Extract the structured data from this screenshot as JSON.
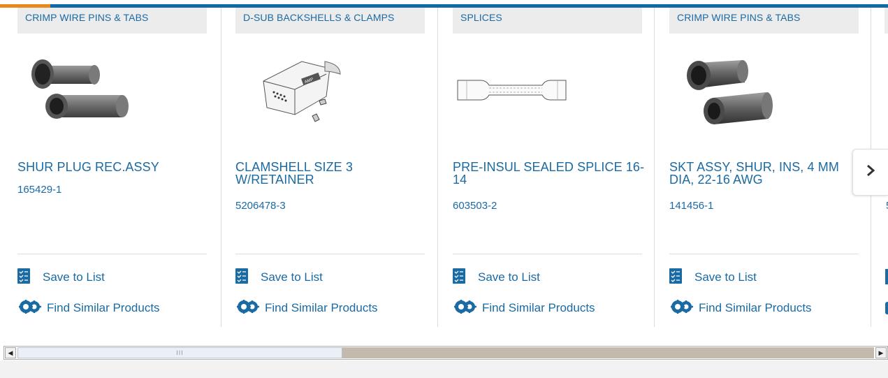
{
  "colors": {
    "accent_blue": "#1a6aa4",
    "top_bar": "#0f6aa8",
    "top_bar_accent": "#e8891d",
    "category_bg": "#ececec"
  },
  "cards": [
    {
      "category": "CRIMP WIRE PINS & TABS",
      "title": "SHUR PLUG REC.ASSY",
      "part_number": "165429-1",
      "save_label": "Save to List",
      "similar_label": "Find Similar Products",
      "image_icon": "crimp-plug-image"
    },
    {
      "category": "D-SUB BACKSHELLS & CLAMPS",
      "title": "CLAMSHELL SIZE 3 W/RETAINER",
      "part_number": "5206478-3",
      "save_label": "Save to List",
      "similar_label": "Find Similar Products",
      "image_icon": "dsub-backshell-image"
    },
    {
      "category": "SPLICES",
      "title": "PRE-INSUL SEALED SPLICE 16-14",
      "part_number": "603503-2",
      "save_label": "Save to List",
      "similar_label": "Find Similar Products",
      "image_icon": "splice-image"
    },
    {
      "category": "CRIMP WIRE PINS & TABS",
      "title": "SKT ASSY, SHUR, INS, 4 MM DIA, 22-16 AWG",
      "part_number": "141456-1",
      "save_label": "Save to List",
      "similar_label": "Find Similar Products",
      "image_icon": "crimp-socket-image"
    }
  ],
  "partial_card": {
    "part_number_fragment": "5"
  },
  "next_button": {
    "icon": "chevron-right-icon"
  },
  "scrollbar": {
    "thumb_grip": "III"
  }
}
